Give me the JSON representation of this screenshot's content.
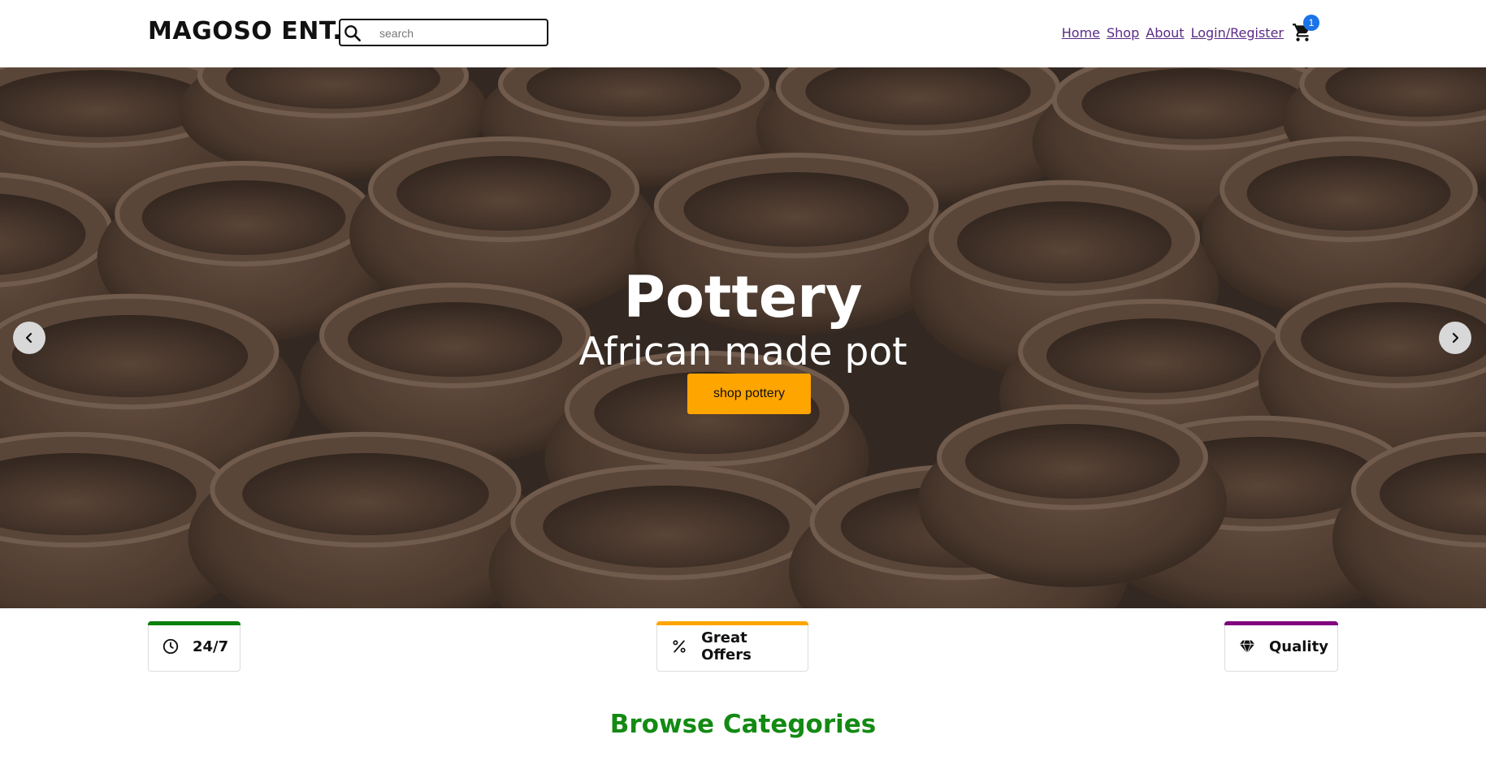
{
  "header": {
    "logo": "MAGOSO ENT.",
    "search": {
      "placeholder": "search",
      "value": "",
      "icon": "search-icon"
    },
    "nav": [
      {
        "label": "Home"
      },
      {
        "label": "Shop"
      },
      {
        "label": "About"
      },
      {
        "label": "Login/Register"
      }
    ],
    "cart": {
      "icon": "cart-icon",
      "count": "1",
      "badge_color": "#1a73e8"
    },
    "link_color": "#5b2a86"
  },
  "hero": {
    "title": "Pottery",
    "subtitle": "African made pot",
    "cta_label": "shop pottery",
    "cta_color": "#ffa500",
    "prev_icon": "chevron-left-icon",
    "next_icon": "chevron-right-icon"
  },
  "features": [
    {
      "label": "24/7",
      "icon": "clock-icon",
      "accent": "#0a7f0a"
    },
    {
      "label": "Great Offers",
      "icon": "percent-icon",
      "accent": "#ffa500"
    },
    {
      "label": "Quality",
      "icon": "diamond-icon",
      "accent": "#800080"
    }
  ],
  "browse": {
    "title": "Browse Categories",
    "color": "#138a13"
  }
}
